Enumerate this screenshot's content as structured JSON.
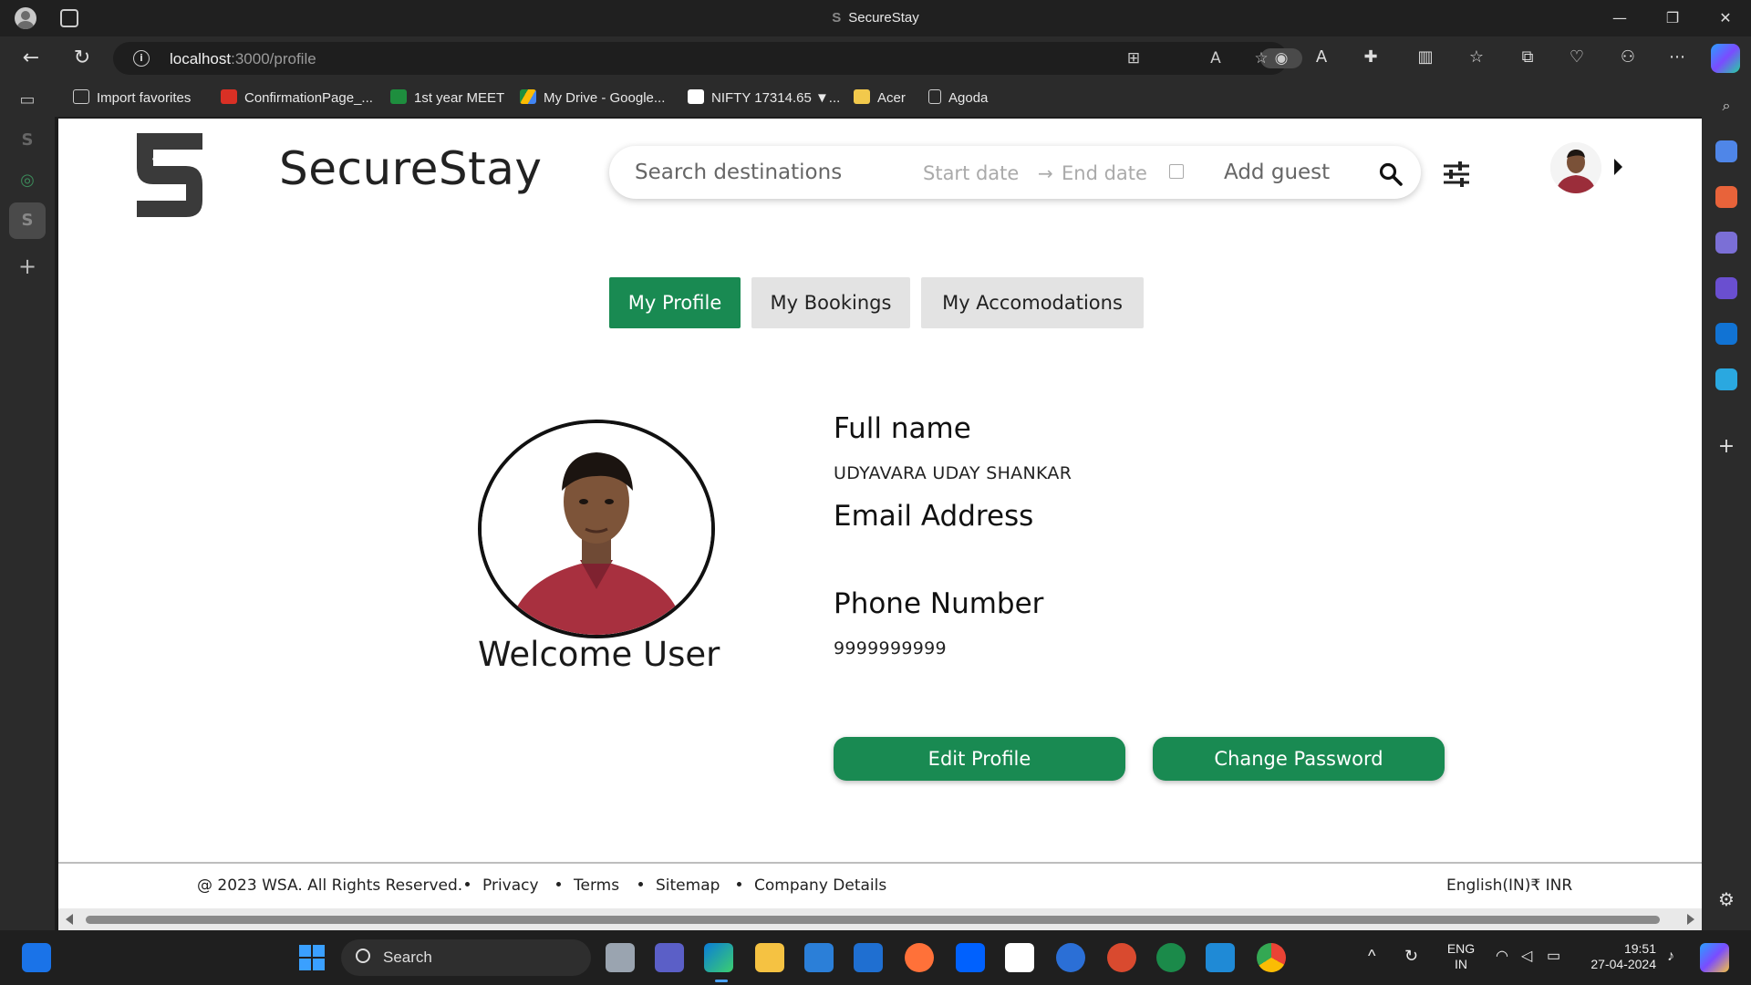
{
  "browser": {
    "window_title": "SecureStay",
    "url_host": "localhost",
    "url_path": ":3000/profile"
  },
  "favorites": [
    {
      "label": "Import favorites",
      "icon": "import-icon",
      "color": "#cccccc"
    },
    {
      "label": "ConfirmationPage_...",
      "icon": "pdf-icon",
      "color": "#d93025"
    },
    {
      "label": "1st year MEET",
      "icon": "meet-icon",
      "color": "#1e8e3e"
    },
    {
      "label": "My Drive - Google...",
      "icon": "drive-icon",
      "color": "#fbbc04"
    },
    {
      "label": "NIFTY 17314.65 ▼...",
      "icon": "tradingview-icon",
      "color": "#ffffff"
    },
    {
      "label": "Acer",
      "icon": "folder-icon",
      "color": "#f2c94c"
    },
    {
      "label": "Agoda",
      "icon": "page-icon",
      "color": "#cccccc"
    }
  ],
  "header": {
    "brand": "SecureStay",
    "search_placeholder": "Search destinations",
    "start_date": "Start date",
    "end_date": "End date",
    "add_guest": "Add guest"
  },
  "tabs": [
    {
      "label": "My Profile",
      "active": true
    },
    {
      "label": "My Bookings",
      "active": false
    },
    {
      "label": "My Accomodations",
      "active": false
    }
  ],
  "profile": {
    "welcome": "Welcome User",
    "full_name_label": "Full name",
    "full_name": "UDYAVARA UDAY SHANKAR",
    "email_label": "Email Address",
    "email": "",
    "phone_label": "Phone Number",
    "phone": "9999999999"
  },
  "actions": {
    "edit_profile": "Edit Profile",
    "change_password": "Change Password"
  },
  "footer": {
    "copyright": "@ 2023 WSA. All Rights Reserved.",
    "links": [
      "Privacy",
      "Terms",
      "Sitemap",
      "Company Details"
    ],
    "locale": "English(IN)₹ INR"
  },
  "taskbar": {
    "search_label": "Search",
    "lang_line1": "ENG",
    "lang_line2": "IN",
    "time": "19:51",
    "date": "27-04-2024"
  },
  "colors": {
    "accent_green": "#198a52",
    "inactive_tab": "#e3e3e3"
  }
}
